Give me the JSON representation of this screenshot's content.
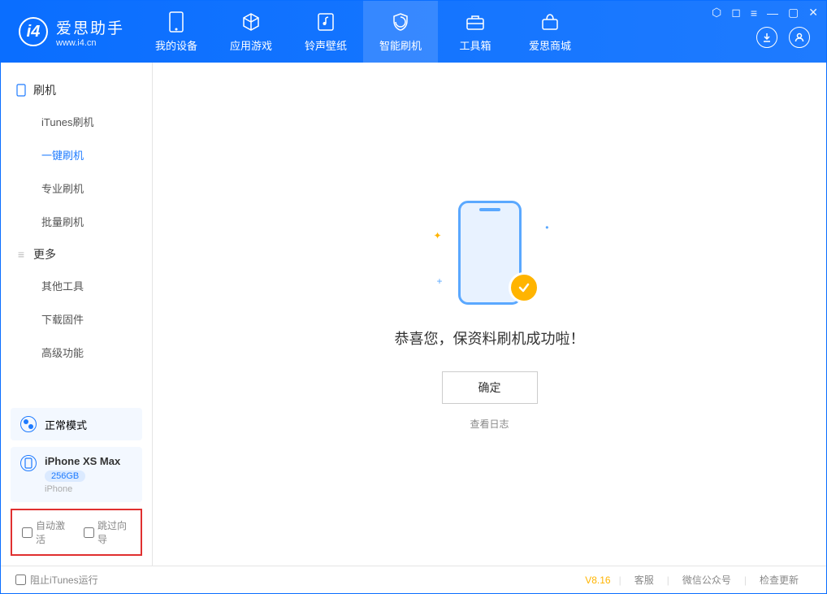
{
  "header": {
    "logo_title": "爱思助手",
    "logo_sub": "www.i4.cn",
    "nav": [
      {
        "label": "我的设备",
        "icon": "device"
      },
      {
        "label": "应用游戏",
        "icon": "cube"
      },
      {
        "label": "铃声壁纸",
        "icon": "music"
      },
      {
        "label": "智能刷机",
        "icon": "shield",
        "active": true
      },
      {
        "label": "工具箱",
        "icon": "toolbox"
      },
      {
        "label": "爱思商城",
        "icon": "shop"
      }
    ]
  },
  "sidebar": {
    "group1_label": "刷机",
    "group1_items": [
      {
        "label": "iTunes刷机"
      },
      {
        "label": "一键刷机",
        "active": true
      },
      {
        "label": "专业刷机"
      },
      {
        "label": "批量刷机"
      }
    ],
    "group2_label": "更多",
    "group2_items": [
      {
        "label": "其他工具"
      },
      {
        "label": "下载固件"
      },
      {
        "label": "高级功能"
      }
    ],
    "mode_label": "正常模式",
    "device": {
      "name": "iPhone XS Max",
      "capacity": "256GB",
      "type": "iPhone"
    },
    "checkbox1": "自动激活",
    "checkbox2": "跳过向导"
  },
  "main": {
    "success_text": "恭喜您，保资料刷机成功啦！",
    "ok_button": "确定",
    "log_link": "查看日志"
  },
  "footer": {
    "block_itunes": "阻止iTunes运行",
    "version": "V8.16",
    "links": [
      "客服",
      "微信公众号",
      "检查更新"
    ]
  }
}
